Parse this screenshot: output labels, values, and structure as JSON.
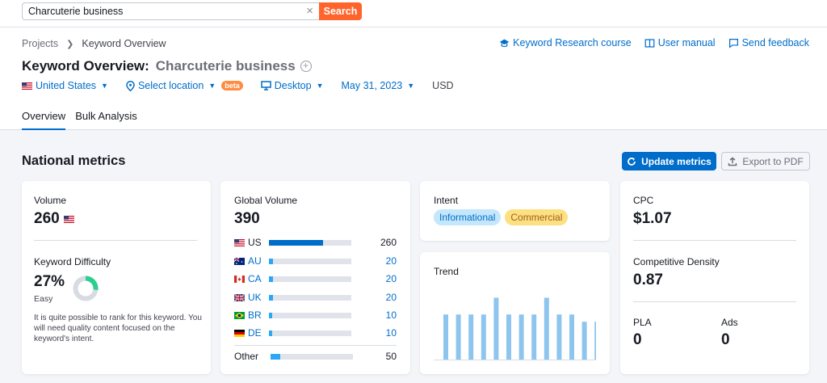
{
  "search": {
    "value": "Charcuterie business",
    "button": "Search"
  },
  "breadcrumb": [
    "Projects",
    "Keyword Overview"
  ],
  "top_links": [
    "Keyword Research course",
    "User manual",
    "Send feedback"
  ],
  "title": {
    "label": "Keyword Overview:",
    "keyword": "Charcuterie business"
  },
  "filters": {
    "country": "United States",
    "location": "Select location",
    "beta": "beta",
    "device": "Desktop",
    "date": "May 31, 2023",
    "currency": "USD"
  },
  "tabs": [
    "Overview",
    "Bulk Analysis"
  ],
  "section": {
    "title": "National metrics",
    "update": "Update metrics",
    "export": "Export to PDF"
  },
  "volume": {
    "label": "Volume",
    "value": "260"
  },
  "kd": {
    "label": "Keyword Difficulty",
    "value": "27%",
    "level": "Easy",
    "percent": 27,
    "description": "It is quite possible to rank for this keyword. You will need quality content focused on the keyword's intent."
  },
  "global_volume": {
    "label": "Global Volume",
    "value": "390",
    "rows": [
      {
        "code": "US",
        "value": "260",
        "fraction": 0.66
      },
      {
        "code": "AU",
        "value": "20",
        "fraction": 0.05
      },
      {
        "code": "CA",
        "value": "20",
        "fraction": 0.05
      },
      {
        "code": "UK",
        "value": "20",
        "fraction": 0.05
      },
      {
        "code": "BR",
        "value": "10",
        "fraction": 0.03
      },
      {
        "code": "DE",
        "value": "10",
        "fraction": 0.03
      }
    ],
    "other": {
      "label": "Other",
      "value": "50",
      "fraction": 0.12
    }
  },
  "intent": {
    "label": "Intent",
    "tags": [
      "Informational",
      "Commercial"
    ]
  },
  "trend": {
    "label": "Trend",
    "values": [
      0.62,
      0.62,
      0.62,
      0.62,
      0.85,
      0.62,
      0.62,
      0.62,
      0.85,
      0.62,
      0.62,
      0.52,
      0.52
    ]
  },
  "cpc": {
    "label": "CPC",
    "value": "$1.07"
  },
  "density": {
    "label": "Competitive Density",
    "value": "0.87"
  },
  "pla": {
    "label": "PLA",
    "value": "0"
  },
  "ads": {
    "label": "Ads",
    "value": "0"
  },
  "colors": {
    "accent": "#006dca",
    "orange": "#ff642d",
    "bar": "#2ba8f5",
    "trend": "#8ec5ef",
    "kd_green": "#2ccf8f"
  }
}
